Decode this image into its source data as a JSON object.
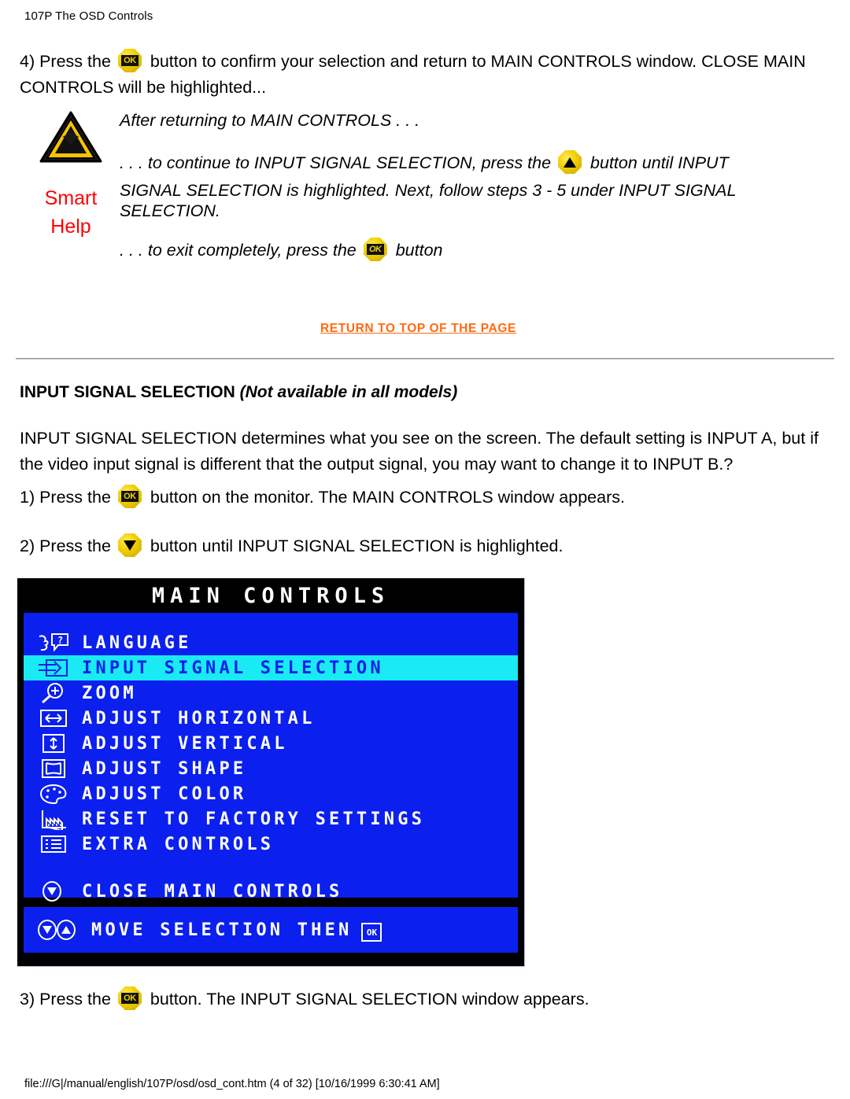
{
  "header": {
    "title": "107P The OSD Controls"
  },
  "step4": {
    "prefix": "4) Press the",
    "button": "OK",
    "suffix": "button to confirm your selection and return to MAIN CONTROLS window. CLOSE MAIN CONTROLS will be highlighted..."
  },
  "smart_help": {
    "icon": "warning-triangle-icon",
    "line1": "Smart",
    "line2": "Help",
    "color": "#ff0000",
    "note_1": "After returning to MAIN CONTROLS . . .",
    "note_2_a": ". . . to continue to INPUT SIGNAL SELECTION, press the",
    "note_2_button": "up-arrow",
    "note_2_b": "button until INPUT",
    "note_3": "SIGNAL SELECTION is highlighted. Next, follow steps 3 - 5 under INPUT SIGNAL",
    "note_4": "SELECTION.",
    "note_5_a": ". . . to exit completely, press the",
    "note_5_button": "OK",
    "note_5_b": "button"
  },
  "return_link": {
    "label": "RETURN TO TOP OF THE PAGE",
    "color": "#ff6a10"
  },
  "section": {
    "heading_bold": "INPUT SIGNAL SELECTION ",
    "heading_italic": "(Not available in all models)",
    "body_line1": "INPUT SIGNAL SELECTION determines what you see on the screen. The default setting is INPUT A, but if",
    "body_line2": "the video input signal is different that the output signal, you may want to change it to INPUT B.?"
  },
  "steps": {
    "step1_prefix": "1) Press the",
    "step1_button": "OK",
    "step1_suffix": "button on the monitor. The MAIN CONTROLS window appears.",
    "step2_prefix": "2) Press the",
    "step2_button": "down-arrow",
    "step2_suffix": "button until INPUT SIGNAL SELECTION is highlighted.",
    "step3_prefix": "3) Press the",
    "step3_button": "OK",
    "step3_suffix": "button. The INPUT SIGNAL SELECTION window appears."
  },
  "osd": {
    "title": "MAIN CONTROLS",
    "title_bg": "#000000",
    "body_bg": "#0b1fef",
    "highlight_bg": "#19eaf4",
    "text_color": "#ffffff",
    "items": [
      {
        "icon": "language-person-question-icon",
        "label": "LANGUAGE",
        "selected": false
      },
      {
        "icon": "input-signal-arrow-icon",
        "label": "INPUT SIGNAL SELECTION",
        "selected": true
      },
      {
        "icon": "zoom-magnifier-plus-icon",
        "label": "ZOOM",
        "selected": false
      },
      {
        "icon": "adjust-horizontal-icon",
        "label": "ADJUST HORIZONTAL",
        "selected": false
      },
      {
        "icon": "adjust-vertical-icon",
        "label": "ADJUST VERTICAL",
        "selected": false
      },
      {
        "icon": "adjust-shape-icon",
        "label": "ADJUST SHAPE",
        "selected": false
      },
      {
        "icon": "adjust-color-palette-icon",
        "label": "ADJUST COLOR",
        "selected": false
      },
      {
        "icon": "reset-factory-icon",
        "label": "RESET TO FACTORY SETTINGS",
        "selected": false
      },
      {
        "icon": "extra-controls-list-icon",
        "label": "EXTRA CONTROLS",
        "selected": false
      }
    ],
    "close_item": {
      "icon": "close-down-arrow-icon",
      "label": "CLOSE MAIN CONTROLS"
    },
    "footer_item": {
      "icon": "move-updown-arrows-icon",
      "label": "MOVE SELECTION THEN",
      "ok_badge": "OK"
    }
  },
  "footer": {
    "url": "file:///G|/manual/english/107P/osd/osd_cont.htm (4 of 32) [10/16/1999 6:30:41 AM]"
  }
}
